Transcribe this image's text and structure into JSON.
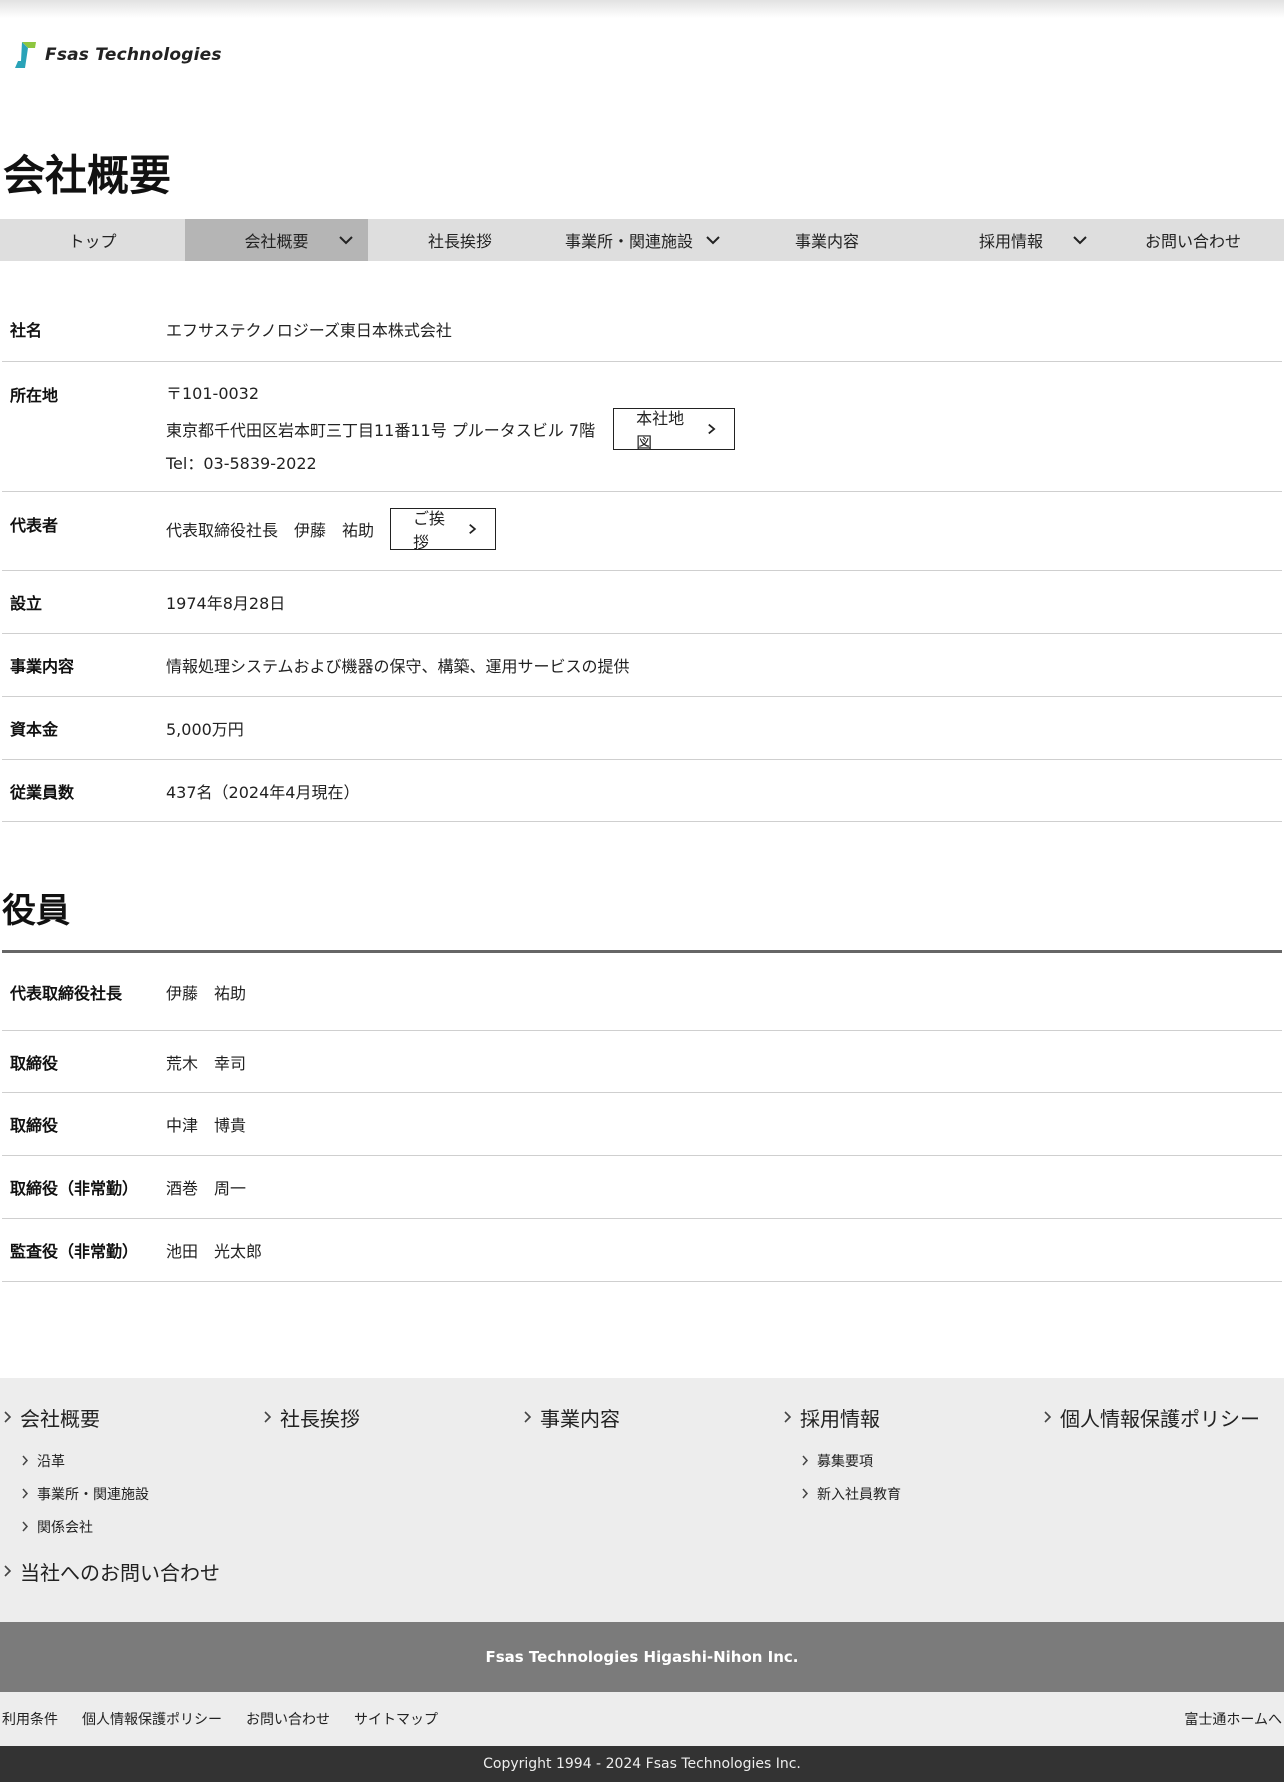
{
  "header": {
    "logo_text": "Fsas Technologies",
    "page_title": "会社概要"
  },
  "nav": {
    "items": [
      {
        "label": "トップ"
      },
      {
        "label": "会社概要"
      },
      {
        "label": "社長挨拶"
      },
      {
        "label": "事業所・関連施設"
      },
      {
        "label": "事業内容"
      },
      {
        "label": "採用情報"
      },
      {
        "label": "お問い合わせ"
      }
    ],
    "active": "会社概要"
  },
  "company": {
    "name_label": "社名",
    "name": "エフサステクノロジーズ東日本株式会社",
    "address_label": "所在地",
    "postal": "〒101-0032",
    "address": "東京都千代田区岩本町三丁目11番11号 プルータスビル 7階",
    "tel": "Tel：03-5839-2022",
    "map_button": "本社地図",
    "rep_label": "代表者",
    "rep": "代表取締役社長　伊藤　祐助",
    "greeting_button": "ご挨拶",
    "founded_label": "設立",
    "founded": "1974年8月28日",
    "business_label": "事業内容",
    "business": "情報処理システムおよび機器の保守、構築、運用サービスの提供",
    "capital_label": "資本金",
    "capital": "5,000万円",
    "employees_label": "従業員数",
    "employees": "437名（2024年4月現在）"
  },
  "officers": {
    "title": "役員",
    "rows": [
      {
        "role": "代表取締役社長",
        "name": "伊藤　祐助"
      },
      {
        "role": "取締役",
        "name": "荒木　幸司"
      },
      {
        "role": "取締役",
        "name": "中津　博貴"
      },
      {
        "role": "取締役（非常勤）",
        "name": "酒巻　周一"
      },
      {
        "role": "監査役（非常勤）",
        "name": "池田　光太郎"
      }
    ]
  },
  "footer_nav": {
    "col1": {
      "title": "会社概要",
      "subs": [
        "沿革",
        "事業所・関連施設",
        "関係会社"
      ]
    },
    "col2": {
      "title": "社長挨拶"
    },
    "col3": {
      "title": "事業内容"
    },
    "col4": {
      "title": "採用情報",
      "subs": [
        "募集要項",
        "新入社員教育"
      ]
    },
    "col5": {
      "title": "個人情報保護ポリシー"
    },
    "contact": "当社へのお問い合わせ"
  },
  "footer": {
    "brand": "Fsas Technologies Higashi-Nihon Inc.",
    "links": [
      "利用条件",
      "個人情報保護ポリシー",
      "お問い合わせ",
      "サイトマップ"
    ],
    "fujitsu_link": "富士通ホームへ",
    "copyright": "Copyright 1994 - 2024 Fsas Technologies Inc."
  },
  "colors": {
    "nav_bg": "#dedede",
    "nav_active_bg": "#b5b5b5",
    "footer_bg": "#ededed",
    "brand_bar": "#7b7b7b",
    "copyright_bar": "#333333",
    "logo_teal": "#2aa3b8",
    "logo_green": "#8dc63f"
  }
}
